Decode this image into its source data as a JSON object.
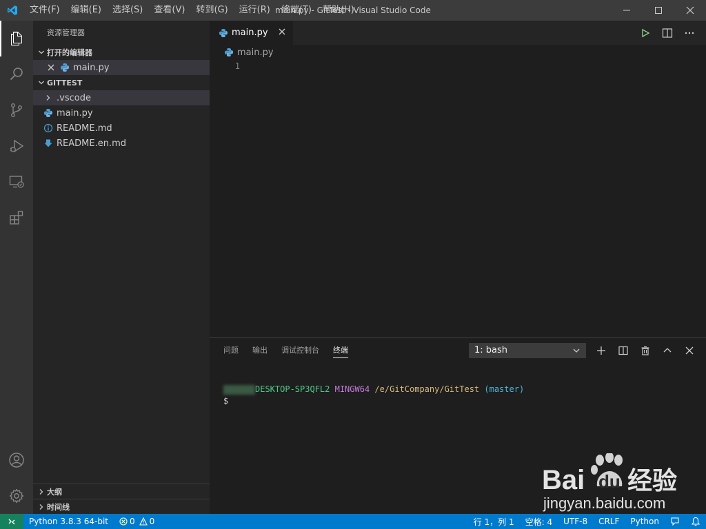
{
  "titlebar": {
    "menu": [
      "文件(F)",
      "编辑(E)",
      "选择(S)",
      "查看(V)",
      "转到(G)",
      "运行(R)",
      "终端(T)",
      "帮助(H)"
    ],
    "window_title": "main.py - GitTest - Visual Studio Code"
  },
  "sidebar": {
    "title": "资源管理器",
    "open_editors": {
      "header": "打开的编辑器",
      "items": [
        {
          "name": "main.py"
        }
      ]
    },
    "workspace": {
      "header": "GITTEST",
      "items": [
        {
          "name": ".vscode",
          "kind": "folder"
        },
        {
          "name": "main.py",
          "kind": "python"
        },
        {
          "name": "README.md",
          "kind": "info"
        },
        {
          "name": "README.en.md",
          "kind": "markdown"
        }
      ]
    },
    "outline_header": "大纲",
    "timeline_header": "时间线"
  },
  "editor": {
    "tab_label": "main.py",
    "breadcrumb": "main.py",
    "line_numbers": [
      "1"
    ]
  },
  "panel": {
    "tabs": [
      "问题",
      "输出",
      "调试控制台",
      "终端"
    ],
    "active_tab": "终端",
    "terminal_select": "1: bash",
    "terminal": {
      "host": "DESKTOP-SP3QFL2",
      "system": "MINGW64",
      "path": "/e/GitCompany/GitTest",
      "branch": "(master)",
      "prompt": "$"
    }
  },
  "statusbar": {
    "python": "Python 3.8.3 64-bit",
    "errors": "0",
    "warnings": "0",
    "position": "行 1，列 1",
    "spaces": "空格: 4",
    "encoding": "UTF-8",
    "eol": "CRLF",
    "language": "Python"
  },
  "watermark": {
    "brand": "Bai",
    "brand2": "du",
    "product": "经验",
    "url": "jingyan.baidu.com"
  },
  "colors": {
    "accent": "#007acc",
    "remote": "#16825d",
    "activitybar": "#333333",
    "sidebar": "#252526",
    "editor": "#1e1e1e"
  }
}
